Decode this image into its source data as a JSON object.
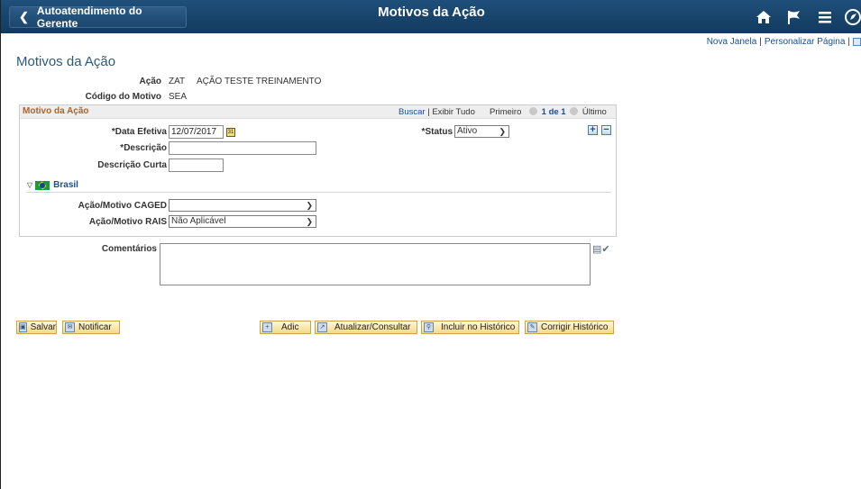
{
  "banner": {
    "back_label": "Autoatendimento do Gerente",
    "title": "Motivos da Ação",
    "icons": [
      "home-icon",
      "flag-icon",
      "menu-icon",
      "navbar-icon"
    ]
  },
  "toplinks": {
    "new_window": "Nova Janela",
    "personalize": "Personalizar Página",
    "separator": "|"
  },
  "page": {
    "title": "Motivos da Ação",
    "acao_label": "Ação",
    "acao_code": "ZAT",
    "acao_desc": "AÇÃO TESTE TREINAMENTO",
    "motivo_label": "Código do Motivo",
    "motivo_code": "SEA"
  },
  "group": {
    "title": "Motivo da Ação",
    "buscar": "Buscar",
    "sep": "|",
    "exibir_tudo": "Exibir Tudo",
    "primeiro": "Primeiro",
    "range": "1 de 1",
    "ultimo": "Último"
  },
  "form": {
    "data_label": "*Data Efetiva",
    "data_value": "12/07/2017",
    "status_label": "*Status",
    "status_value": "Ativo",
    "descricao_label": "*Descrição",
    "descricao_value": "",
    "desc_curta_label": "Descrição Curta",
    "desc_curta_value": "",
    "brasil": "Brasil",
    "caged_label": "Ação/Motivo CAGED",
    "caged_value": "",
    "rais_label": "Ação/Motivo RAIS",
    "rais_value": "Não Aplicável"
  },
  "comments": {
    "label": "Comentários"
  },
  "buttons": {
    "salvar": "Salvar",
    "notificar": "Notificar",
    "adic": "Adic",
    "atualizar": "Atualizar/Consultar",
    "incluir": "Incluir no Histórico",
    "corrigir": "Corrigir Histórico"
  }
}
